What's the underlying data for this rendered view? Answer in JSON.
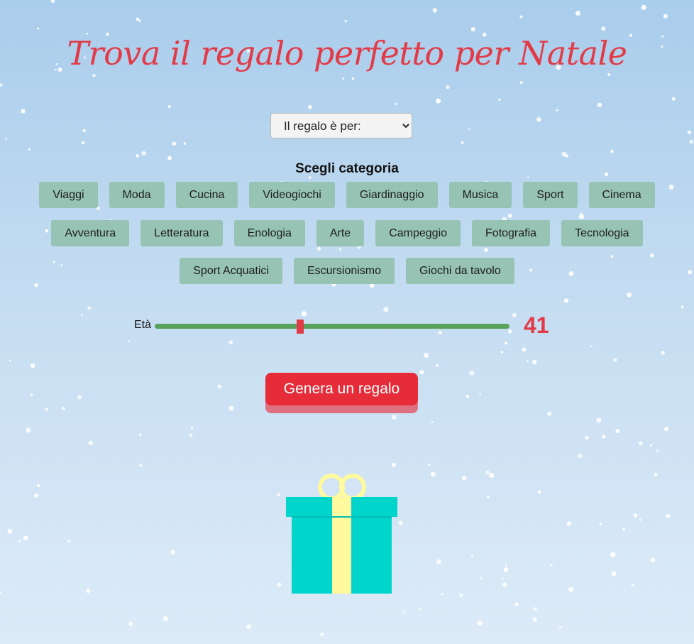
{
  "title": "Trova il regalo perfetto per Natale",
  "recipient_select": {
    "selected": "Il regalo è per:",
    "options": [
      "Il regalo è per:"
    ]
  },
  "category_label": "Scegli categoria",
  "categories": [
    [
      "Viaggi",
      "Moda",
      "Cucina",
      "Videogiochi",
      "Giardinaggio",
      "Musica",
      "Sport",
      "Cinema"
    ],
    [
      "Avventura",
      "Letteratura",
      "Enologia",
      "Arte",
      "Campeggio",
      "Fotografia",
      "Tecnologia"
    ],
    [
      "Sport Acquatici",
      "Escursionismo",
      "Giochi da tavolo"
    ]
  ],
  "age": {
    "label": "Età",
    "value": "41",
    "min": 0,
    "max": 100
  },
  "generate_button": "Genera un regalo",
  "colors": {
    "accent_red": "#e23b47",
    "category_button": "#96c3b3",
    "slider_track": "#58a25d",
    "gift_box": "#00d5cb",
    "gift_ribbon": "#fffa9e"
  }
}
